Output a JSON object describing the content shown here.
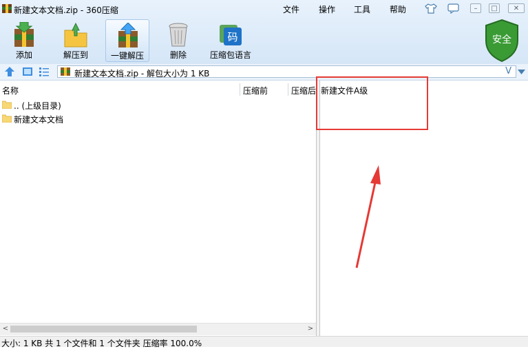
{
  "window": {
    "title": "新建文本文档.zip - 360压缩",
    "menus": [
      "文件",
      "操作",
      "工具",
      "帮助"
    ]
  },
  "toolbar": {
    "items": [
      {
        "label": "添加",
        "icon": "add-archive-icon"
      },
      {
        "label": "解压到",
        "icon": "extract-to-icon"
      },
      {
        "label": "一键解压",
        "icon": "one-click-extract-icon",
        "active": true
      },
      {
        "label": "删除",
        "icon": "trash-bin-icon"
      },
      {
        "label": "压缩包语言",
        "icon": "archive-language-icon"
      }
    ],
    "security_badge": "安全"
  },
  "pathbar": {
    "text": "新建文本文档.zip - 解包大小为 1 KB",
    "dropdown_glyph": "V"
  },
  "file_list": {
    "columns": [
      "名称",
      "压缩前",
      "压缩后"
    ],
    "rows": [
      {
        "name": ".. (上级目录)",
        "icon": "folder-icon"
      },
      {
        "name": "新建文本文档",
        "icon": "folder-icon"
      }
    ]
  },
  "comment_panel": {
    "text": "新建文件A级"
  },
  "statusbar": {
    "text": "大小: 1 KB 共 1 个文件和 1 个文件夹 压缩率 100.0%"
  },
  "colors": {
    "accent": "#2f6fb5",
    "shield": "#3a9b35",
    "annotation": "#e53935"
  }
}
